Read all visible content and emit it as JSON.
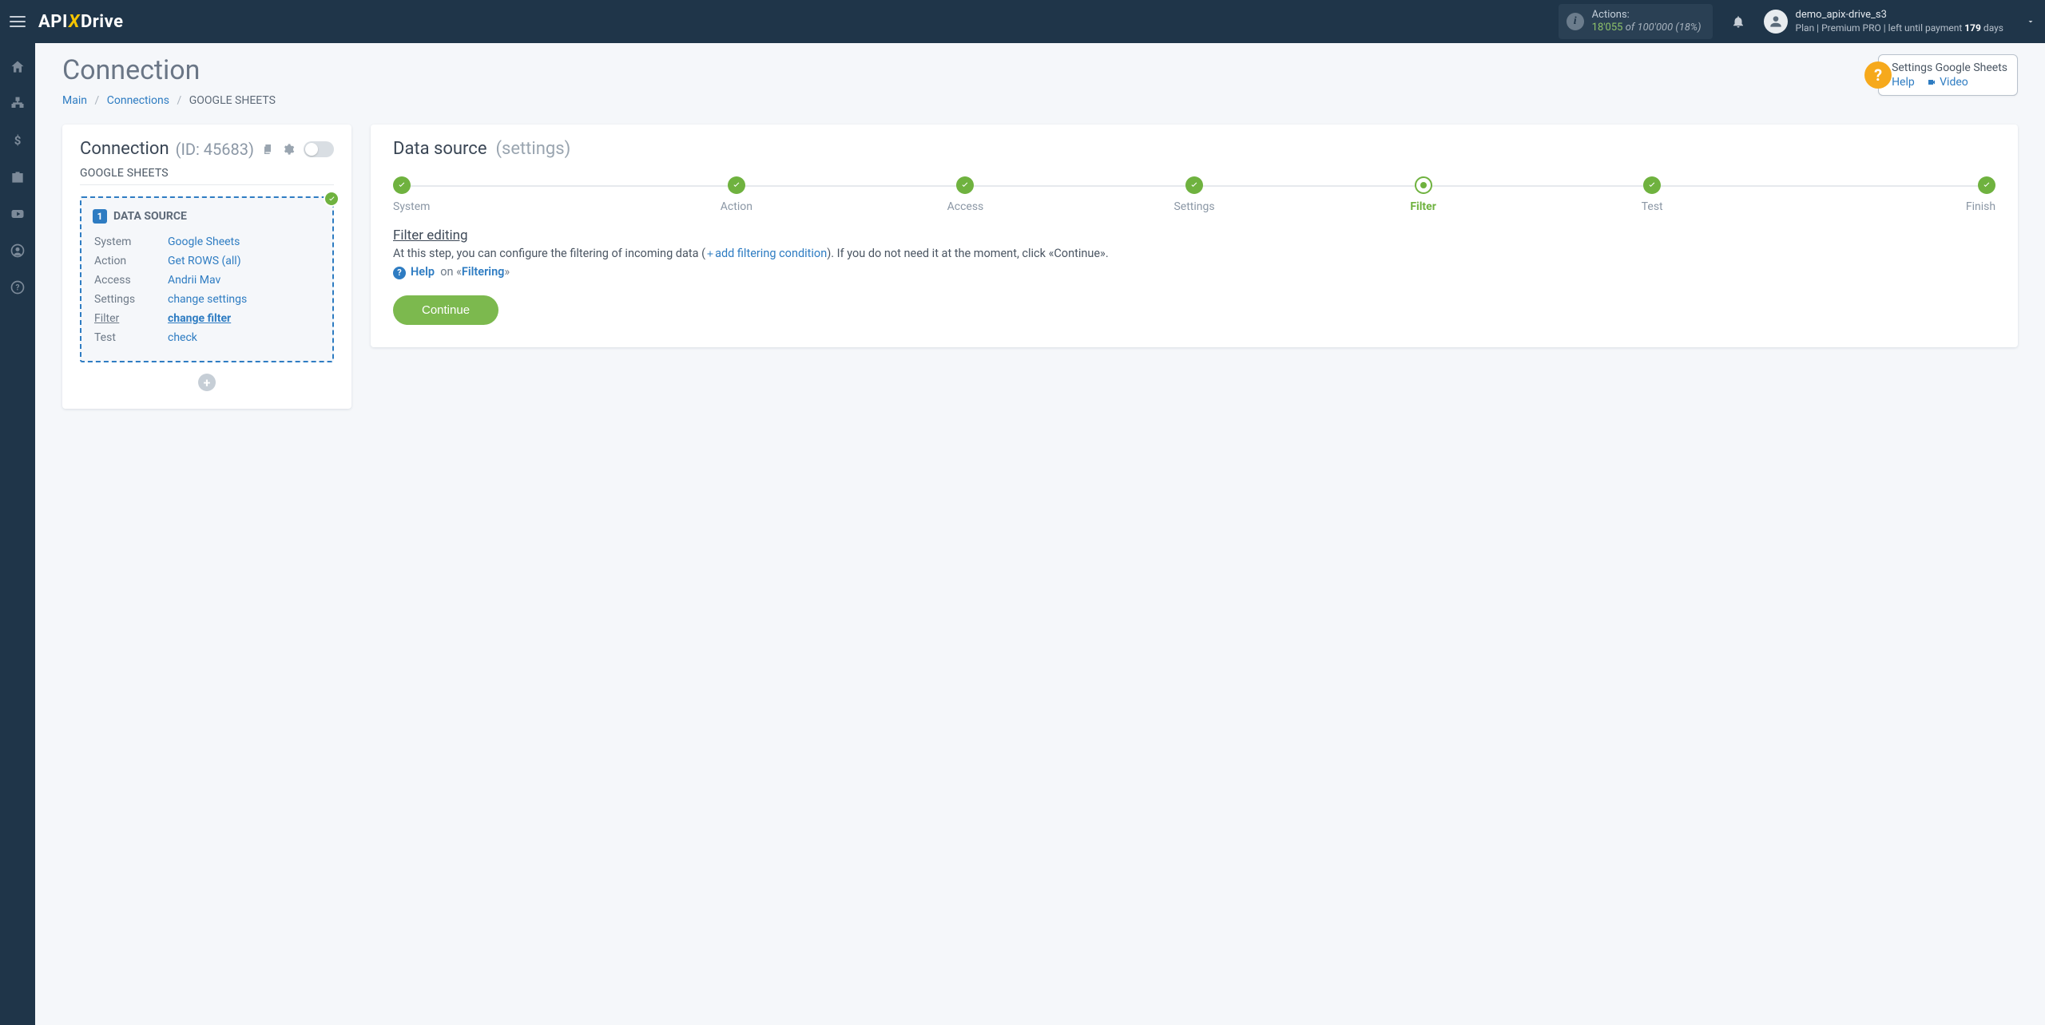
{
  "header": {
    "logo_pre": "API",
    "logo_x": "X",
    "logo_post": "Drive",
    "actions_label": "Actions:",
    "actions_used": "18'055",
    "actions_of_word": "of",
    "actions_total": "100'000",
    "actions_pct": "(18%)",
    "username": "demo_apix-drive_s3",
    "plan_prefix": "Plan |",
    "plan_name": "Premium PRO",
    "plan_mid": "| left until payment",
    "plan_days_num": "179",
    "plan_days_word": "days"
  },
  "rail_icons": [
    "home",
    "sitemap",
    "dollar",
    "briefcase",
    "youtube",
    "user",
    "question"
  ],
  "page": {
    "title": "Connection",
    "breadcrumbs": {
      "main": "Main",
      "connections": "Connections",
      "current": "GOOGLE SHEETS"
    }
  },
  "help_card": {
    "title": "Settings Google Sheets",
    "help_link": "Help",
    "video_link": "Video"
  },
  "left_card": {
    "heading": "Connection",
    "id_text": "(ID: 45683)",
    "service": "GOOGLE SHEETS",
    "ds_title": "DATA SOURCE",
    "rows": {
      "system_label": "System",
      "system_value": "Google Sheets",
      "action_label": "Action",
      "action_value": "Get ROWS (all)",
      "access_label": "Access",
      "access_value": "Andrii Mav",
      "settings_label": "Settings",
      "settings_value": "change settings",
      "filter_label": "Filter",
      "filter_value": "change filter",
      "test_label": "Test",
      "test_value": "check"
    }
  },
  "right_card": {
    "heading": "Data source",
    "heading_sub": "(settings)",
    "steps": [
      "System",
      "Action",
      "Access",
      "Settings",
      "Filter",
      "Test",
      "Finish"
    ],
    "current_step_index": 4,
    "section_title": "Filter editing",
    "desc_pre": "At this step, you can configure the filtering of incoming data (",
    "desc_link": "add filtering condition",
    "desc_post": "). If you do not need it at the moment, click «Continue».",
    "help_word": "Help",
    "help_on": "on «",
    "help_topic": "Filtering",
    "help_close": "»",
    "continue": "Continue"
  }
}
